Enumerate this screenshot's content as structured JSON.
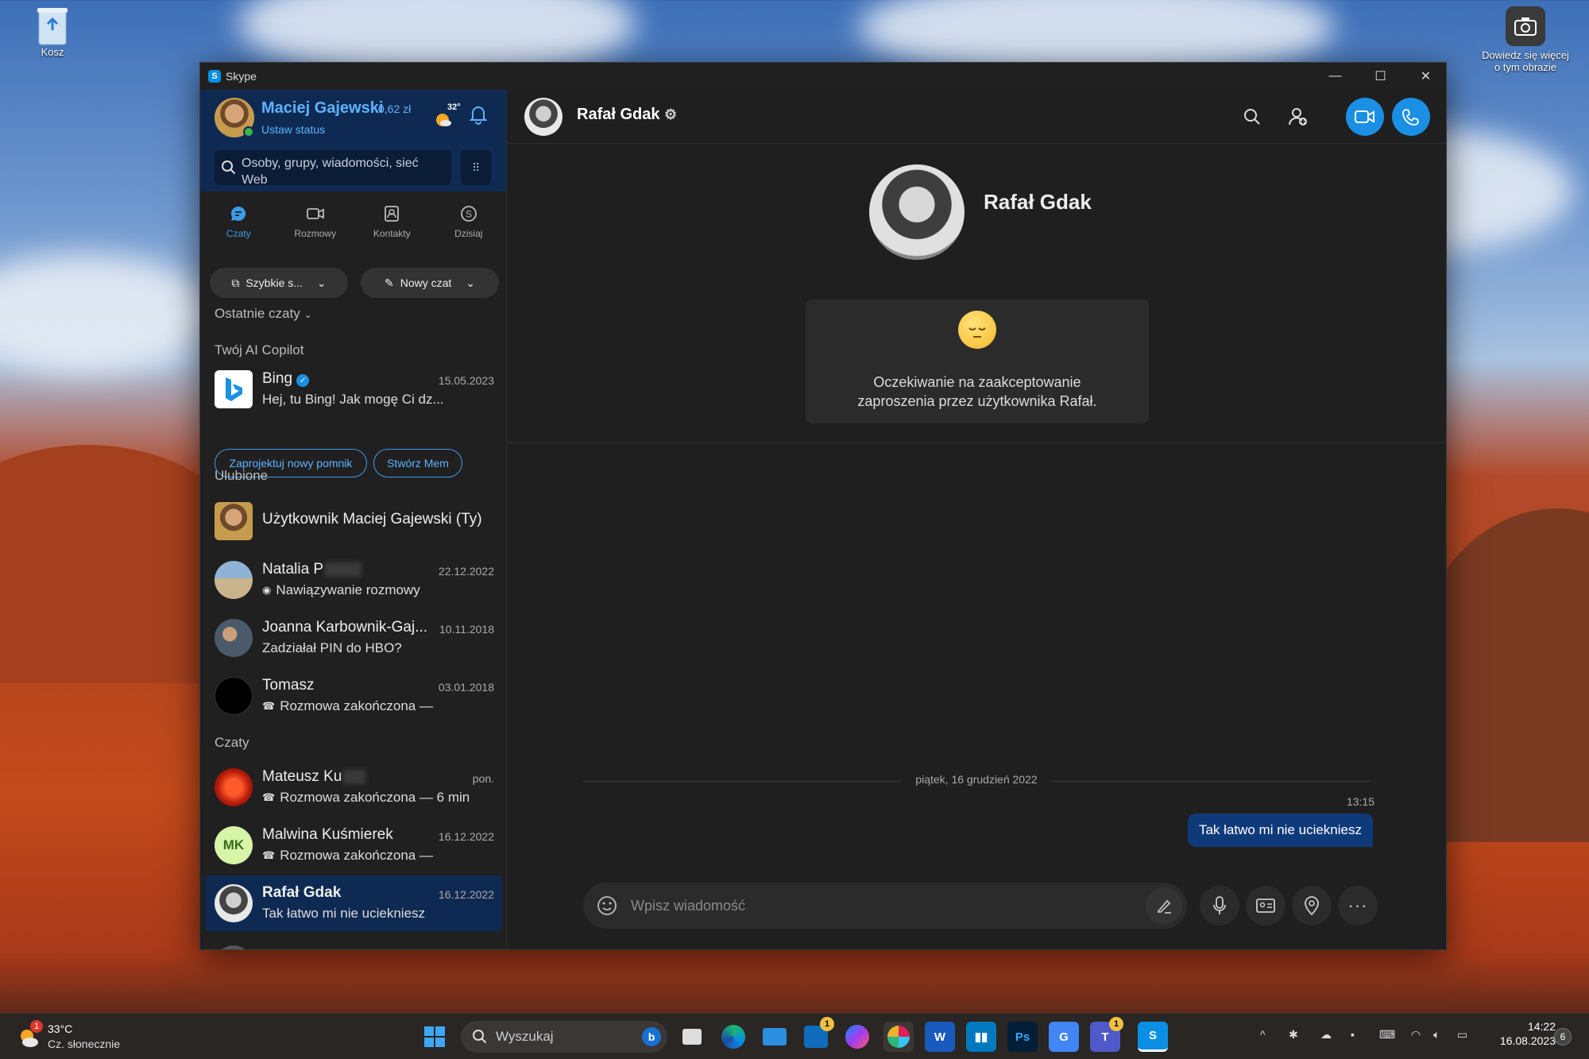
{
  "desktop": {
    "recycle_bin_label": "Kosz",
    "spotlight_label_line1": "Dowiedz się więcej",
    "spotlight_label_line2": "o tym obrazie"
  },
  "window": {
    "app_title": "Skype",
    "controls": {
      "minimize": "—",
      "maximize": "☐",
      "close": "✕"
    }
  },
  "profile": {
    "name": "Maciej Gajewski",
    "balance": "0,62 zł",
    "status_link": "Ustaw status",
    "temperature": "32°",
    "search_placeholder_line1": "Osoby, grupy, wiadomości, sieć",
    "search_placeholder_line2": "Web"
  },
  "nav_tabs": [
    {
      "label": "Czaty",
      "icon": "chat-icon",
      "active": true
    },
    {
      "label": "Rozmowy",
      "icon": "video-icon",
      "active": false
    },
    {
      "label": "Kontakty",
      "icon": "contacts-icon",
      "active": false
    },
    {
      "label": "Dzisiaj",
      "icon": "skype-icon",
      "active": false
    }
  ],
  "actions": {
    "quick": "Szybkie s...",
    "new_chat": "Nowy czat"
  },
  "sections": {
    "recent": "Ostatnie czaty",
    "copilot": "Twój AI Copilot",
    "favorites": "Ulubione",
    "chats": "Czaty"
  },
  "bing": {
    "name": "Bing",
    "date": "15.05.2023",
    "preview": "Hej, tu Bing! Jak mogę Ci dz...",
    "chips": [
      "Zaprojektuj nowy pomnik",
      "Stwórz Mem"
    ]
  },
  "favorites": [
    {
      "name": "Użytkownik Maciej Gajewski (Ty)",
      "date": "",
      "preview": ""
    },
    {
      "name": "Natalia P",
      "date": "22.12.2022",
      "preview": "Nawiązywanie rozmowy"
    },
    {
      "name": "Joanna Karbownik-Gaj...",
      "date": "10.11.2018",
      "preview": "Zadziałał PIN do HBO?"
    },
    {
      "name": "Tomasz",
      "date": "03.01.2018",
      "preview": "Rozmowa zakończona —"
    }
  ],
  "chats": [
    {
      "name": "Mateusz Ku",
      "date": "pon.",
      "preview": "Rozmowa zakończona — 6 min"
    },
    {
      "name": "Malwina Kuśmierek",
      "date": "16.12.2022",
      "preview": "Rozmowa zakończona —",
      "initials": "MK"
    },
    {
      "name": "Rafał  Gdak",
      "date": "16.12.2022",
      "preview": "Tak łatwo mi nie uciekniesz"
    }
  ],
  "conversation": {
    "contact_name": "Rafał  Gdak",
    "pending_text_line1": "Oczekiwanie na zaakceptowanie",
    "pending_text_line2": "zaproszenia przez użytkownika Rafał.",
    "date_separator": "piątek, 16 grudzień 2022",
    "message_time": "13:15",
    "message_text": "Tak łatwo mi nie uciekniesz",
    "composer_placeholder": "Wpisz wiadomość"
  },
  "taskbar": {
    "weather_temp": "33°C",
    "weather_desc": "Cz. słonecznie",
    "weather_badge": "1",
    "search_label": "Wyszukaj",
    "outlook_badge": "1",
    "teams_badge": "1",
    "time": "14:22",
    "date": "16.08.2023",
    "notif_count": "6"
  },
  "colors": {
    "accent": "#1a8fe3",
    "profile_bg": "#0f2a52",
    "window_bg": "#1f1f1f"
  }
}
